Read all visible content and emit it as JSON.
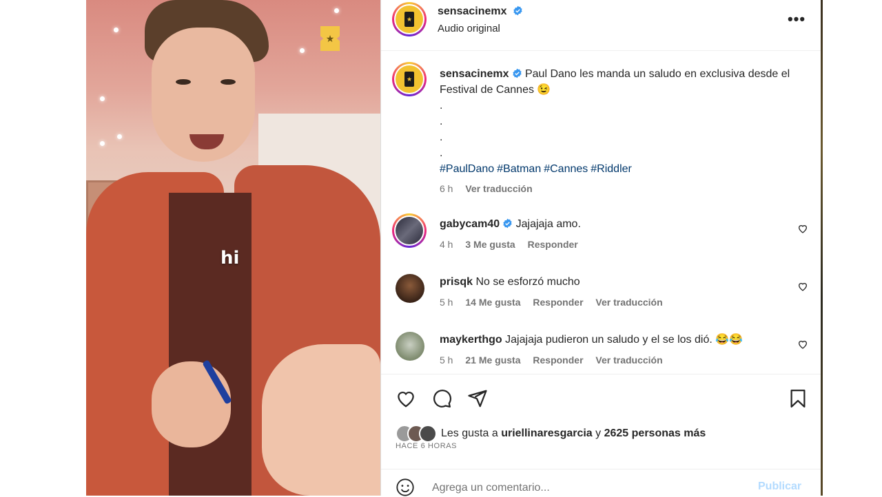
{
  "video": {
    "caption": "hi",
    "mute_icon": "speaker-muted-icon"
  },
  "header": {
    "username": "sensacinemx",
    "subtitle": "Audio original",
    "more_icon": "ellipsis-icon",
    "more_label": "•••"
  },
  "post": {
    "username": "sensacinemx",
    "text": "Paul Dano les manda un saludo en exclusiva desde el Festival de Cannes 😉",
    "dots": [
      ".",
      ".",
      ".",
      "."
    ],
    "hashtags": [
      "#PaulDano",
      "#Batman",
      "#Cannes",
      "#Riddler"
    ],
    "time": "6 h",
    "translate": "Ver traducción"
  },
  "comments": [
    {
      "user": "gabycam40",
      "verified": true,
      "text": "Jajajaja amo.",
      "time": "4 h",
      "likes": "3 Me gusta",
      "reply": "Responder",
      "translate": ""
    },
    {
      "user": "prisqk",
      "verified": false,
      "text": "No se esforzó mucho",
      "time": "5 h",
      "likes": "14 Me gusta",
      "reply": "Responder",
      "translate": "Ver traducción"
    },
    {
      "user": "maykerthgo",
      "verified": false,
      "text": "Jajajaja pudieron un saludo y el se los dió. 😂😂",
      "time": "5 h",
      "likes": "21 Me gusta",
      "reply": "Responder",
      "translate": "Ver traducción"
    }
  ],
  "actions": {
    "liked_by_prefix": "Les gusta a",
    "liked_by_user": "uriellinaresgarcia",
    "liked_by_joiner": "y",
    "liked_by_rest": "2625 personas más",
    "time_ago": "HACE 6 HORAS"
  },
  "add_comment": {
    "placeholder": "Agrega un comentario...",
    "publish": "Publicar"
  },
  "colors": {
    "link": "#00376b",
    "verified": "#3897f0",
    "publish_disabled": "#b3dbff",
    "muted_text": "#737373"
  }
}
